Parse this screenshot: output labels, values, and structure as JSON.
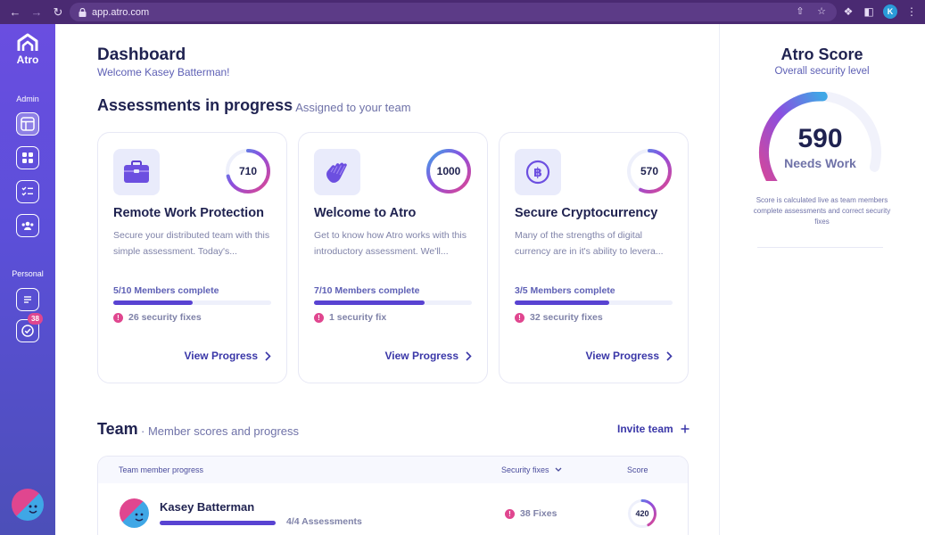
{
  "browser": {
    "url": "app.atro.com",
    "profile_initial": "K"
  },
  "sidebar": {
    "brand": "Atro",
    "admin_label": "Admin",
    "personal_label": "Personal",
    "badge_count": "38"
  },
  "header": {
    "title": "Dashboard",
    "welcome": "Welcome Kasey Batterman!"
  },
  "assessments": {
    "title": "Assessments in progress",
    "subtitle": "· Assigned to your team",
    "cards": [
      {
        "icon": "briefcase-icon",
        "score": "710",
        "score_fraction": 0.71,
        "title": "Remote Work Protection",
        "description": "Secure your distributed team with this simple assessment. Today's...",
        "members": "5/10 Members complete",
        "progress": 0.5,
        "fixes": "26 security fixes",
        "link": "View Progress"
      },
      {
        "icon": "hand-wave-icon",
        "score": "1000",
        "score_fraction": 1.0,
        "title": "Welcome to Atro",
        "description": "Get to know how Atro works with this introductory assessment. We'll...",
        "members": "7/10 Members complete",
        "progress": 0.7,
        "fixes": "1 security fix",
        "link": "View Progress"
      },
      {
        "icon": "bitcoin-icon",
        "score": "570",
        "score_fraction": 0.57,
        "title": "Secure Cryptocurrency",
        "description": "Many of the strengths of digital currency are in it's ability to levera...",
        "members": "3/5 Members complete",
        "progress": 0.6,
        "fixes": "32 security fixes",
        "link": "View Progress"
      }
    ]
  },
  "team": {
    "title": "Team",
    "subtitle": "· Member scores and progress",
    "invite_label": "Invite team",
    "columns": {
      "member": "Team member progress",
      "fixes": "Security fixes",
      "score": "Score"
    },
    "rows": [
      {
        "name": "Kasey Batterman",
        "progress": 1.0,
        "assessments": "4/4 Assessments",
        "fixes": "38 Fixes",
        "score": "420",
        "score_fraction": 0.42
      }
    ]
  },
  "score_panel": {
    "title": "Atro Score",
    "subtitle": "Overall security level",
    "score": "590",
    "score_fraction": 0.59,
    "status": "Needs Work",
    "note": "Score is calculated live as team members complete assessments and correct security fixes"
  },
  "colors": {
    "accent": "#5943d2",
    "ring_start": "#e0468f",
    "ring_mid": "#8a4fe0",
    "ring_end": "#3fa7e6",
    "alert": "#e0468f"
  }
}
